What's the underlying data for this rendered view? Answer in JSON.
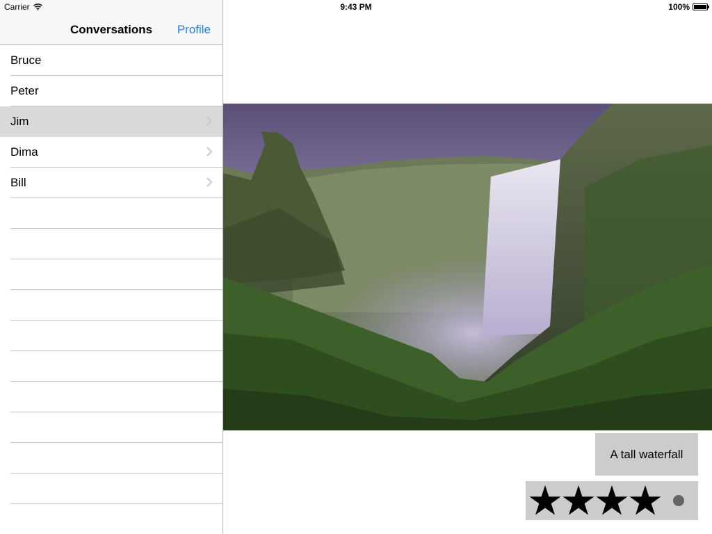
{
  "status_bar": {
    "carrier": "Carrier",
    "time": "9:43 PM",
    "battery": "100%",
    "battery_level": 1.0,
    "wifi_icon": "wifi-icon"
  },
  "master": {
    "nav_title": "Conversations",
    "nav_right_button": "Profile",
    "accent_color": "#1a82fb",
    "items": [
      {
        "label": "Bruce",
        "chevron": false,
        "selected": false
      },
      {
        "label": "Peter",
        "chevron": false,
        "selected": false
      },
      {
        "label": "Jim",
        "chevron": true,
        "selected": true
      },
      {
        "label": "Dima",
        "chevron": true,
        "selected": false
      },
      {
        "label": "Bill",
        "chevron": true,
        "selected": false
      }
    ],
    "empty_rows": 11
  },
  "detail": {
    "photo_subject": "waterfall-photo",
    "caption": "A tall waterfall",
    "rating": {
      "stars": 4,
      "max": 5
    }
  }
}
